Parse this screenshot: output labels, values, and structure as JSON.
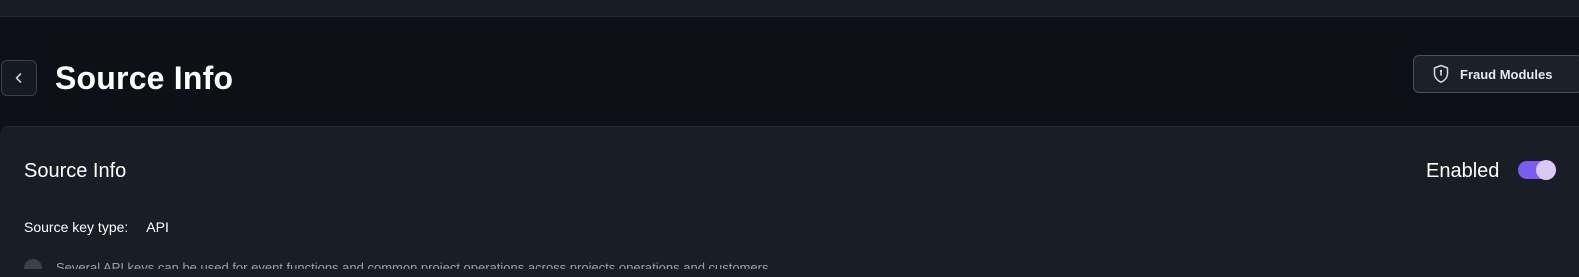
{
  "header": {
    "title": "Source Info",
    "fraud_modules_label": "Fraud Modules"
  },
  "card": {
    "title": "Source Info",
    "enabled_label": "Enabled",
    "enabled": true,
    "source_key_type_label": "Source key type:",
    "source_key_type_value": "API",
    "description": "Several API keys can be used for event functions and common project operations across projects operations and customers"
  },
  "colors": {
    "accent": "#7b5bf0",
    "background": "#0d1017",
    "card": "#191d25"
  },
  "icons": {
    "back": "chevron-left-icon",
    "fraud": "shield-icon",
    "info": "info-icon"
  }
}
